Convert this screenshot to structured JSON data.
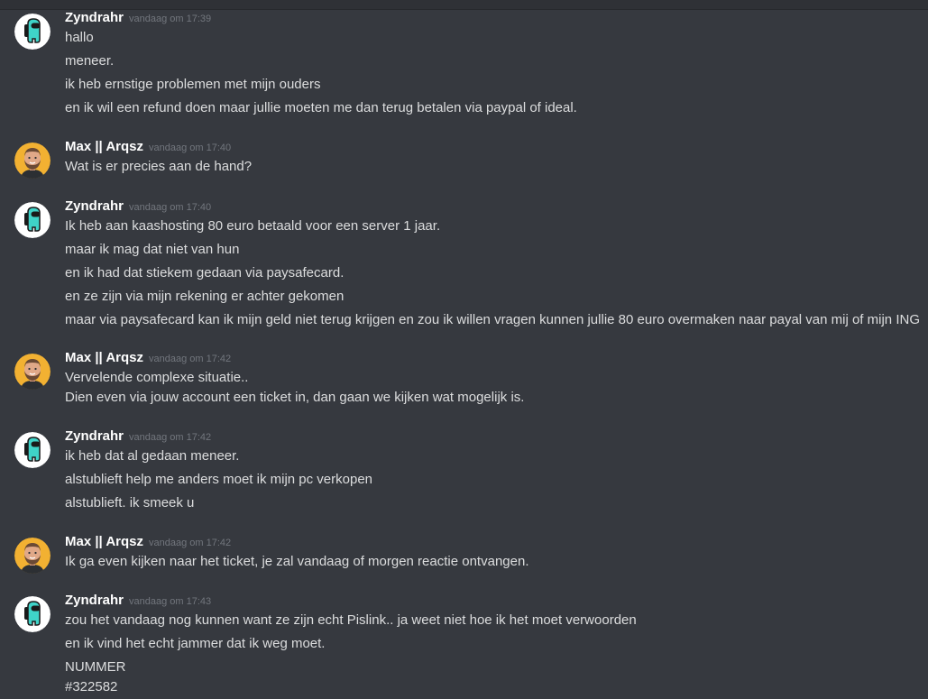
{
  "messages": [
    {
      "author": "Zyndrahr",
      "avatar": "among-us-avatar",
      "timestamp": "vandaag om 17:39",
      "lines": [
        "hallo",
        "meneer.",
        "ik heb ernstige problemen met mijn ouders",
        "en ik wil een refund doen maar jullie moeten me dan terug betalen via paypal of ideal."
      ]
    },
    {
      "author": "Max || Arqsz",
      "avatar": "bearded-man-avatar",
      "timestamp": "vandaag om 17:40",
      "lines": [
        "Wat is er precies aan de hand?"
      ]
    },
    {
      "author": "Zyndrahr",
      "avatar": "among-us-avatar",
      "timestamp": "vandaag om 17:40",
      "lines": [
        "Ik heb aan kaashosting 80 euro betaald voor een server 1 jaar.",
        "maar ik mag dat niet van hun",
        "en ik had dat stiekem gedaan via paysafecard.",
        "en ze zijn via mijn rekening er achter gekomen",
        "maar via paysafecard kan ik mijn geld niet terug krijgen en zou ik willen vragen kunnen jullie 80 euro overmaken naar payal van mij of mijn ING"
      ]
    },
    {
      "author": "Max || Arqsz",
      "avatar": "bearded-man-avatar",
      "timestamp": "vandaag om 17:42",
      "lines": [
        "Vervelende complexe situatie..",
        "Dien even via jouw account een ticket in, dan gaan we kijken wat mogelijk is."
      ]
    },
    {
      "author": "Zyndrahr",
      "avatar": "among-us-avatar",
      "timestamp": "vandaag om 17:42",
      "lines": [
        "ik heb dat al gedaan meneer.",
        "alstublieft help me anders moet ik mijn pc verkopen",
        "alstublieft. ik smeek u"
      ]
    },
    {
      "author": "Max || Arqsz",
      "avatar": "bearded-man-avatar",
      "timestamp": "vandaag om 17:42",
      "lines": [
        "Ik ga even kijken naar het ticket, je zal vandaag of morgen reactie ontvangen."
      ]
    },
    {
      "author": "Zyndrahr",
      "avatar": "among-us-avatar",
      "timestamp": "vandaag om 17:43",
      "lines": [
        "zou het vandaag nog kunnen want ze zijn echt Pislink.. ja weet niet hoe ik het moet verwoorden",
        "en ik vind het echt jammer dat ik weg moet.",
        "NUMMER",
        "#322582"
      ]
    }
  ],
  "colors": {
    "background": "#36393f",
    "username": "#ffffff",
    "timestamp": "#72767d",
    "text": "#dcddde",
    "among_us_body": "#3fd3c8",
    "bearded_avatar_bg": "#f2b132"
  }
}
